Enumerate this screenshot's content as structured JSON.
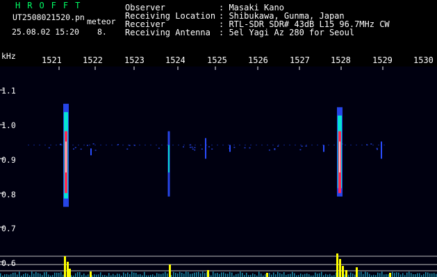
{
  "app": {
    "name": "HROFFT"
  },
  "header": {
    "filename": "UT2508021520.pn",
    "mode": "meteor",
    "datetime": "25.08.02 15:20",
    "count": "8.",
    "fields": [
      {
        "label": "Observer",
        "value": ": Masaki Kano"
      },
      {
        "label": "Receiving Location",
        "value": ": Shibukawa, Gunma, Japan"
      },
      {
        "label": "Receiver",
        "value": ": RTL-SDR SDR# 43dB L15 96.7MHz CW"
      },
      {
        "label": "Receiving Antenna",
        "value": ": 5el Yagi Az 280 for Seoul"
      }
    ]
  },
  "chart_data": {
    "type": "heatmap",
    "ylabel": "kHz",
    "x_ticks": [
      "1521",
      "1522",
      "1523",
      "1524",
      "1525",
      "1526",
      "1527",
      "1528",
      "1529",
      "1530"
    ],
    "y_ticks": [
      "1.1",
      "1.0",
      "0.9",
      "0.8",
      "0.7",
      "0.6"
    ],
    "ylim": [
      0.57,
      1.15
    ],
    "events": [
      {
        "x": "1521",
        "y_low": 0.76,
        "y_high": 1.06,
        "intensity": "strong"
      },
      {
        "x": "1528",
        "y_low": 0.79,
        "y_high": 1.05,
        "intensity": "strong"
      },
      {
        "x": "1524",
        "y_low": 0.79,
        "y_high": 0.98,
        "intensity": "weak"
      }
    ],
    "colors": {
      "strong": "#ff2a55",
      "medium": "#00ffd0",
      "weak": "#2a4dff",
      "peak": "#ffff00",
      "background": "#000010"
    }
  }
}
